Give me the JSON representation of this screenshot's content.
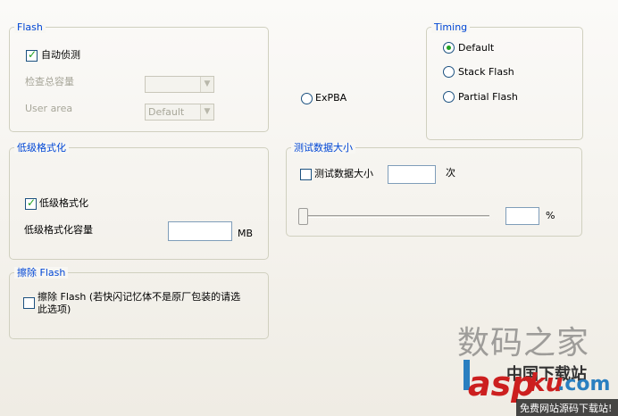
{
  "flash_group": {
    "title": "Flash",
    "auto_detect": {
      "label": "自动侦测",
      "checked": true
    },
    "total_capacity_label": "检查总容量",
    "total_capacity_value": "",
    "user_area_label": "User area",
    "user_area_value": "Default"
  },
  "timing_group": {
    "title": "Timing",
    "options": [
      {
        "label": "Default",
        "selected": true
      },
      {
        "label": "Stack Flash",
        "selected": false
      },
      {
        "label": "Partial Flash",
        "selected": false
      }
    ]
  },
  "expba": {
    "label": "ExPBA",
    "selected": false
  },
  "low_format_group": {
    "title": "低级格式化",
    "checkbox": {
      "label": "低级格式化",
      "checked": true
    },
    "capacity_label": "低级格式化容量",
    "capacity_value": "",
    "unit": "MB"
  },
  "test_group": {
    "title": "测试数据大小",
    "checkbox": {
      "label": "测试数据大小",
      "checked": false
    },
    "count_value": "",
    "count_unit": "次",
    "slider_value": 0,
    "percent_value": "",
    "percent_unit": "%"
  },
  "erase_group": {
    "title": "擦除 Flash",
    "checkbox": {
      "label_line1": "擦除 Flash (若快闪记忆体不是原厂包装的请选",
      "label_line2": "此选项)",
      "checked": false
    }
  },
  "watermark": {
    "line1": "数码之家",
    "line2": "asp",
    "line3": "ku",
    "line4": ".com",
    "cn": "中国下载站",
    "footer": "免费网站源码下载站!"
  },
  "colors": {
    "accent": "#0046d5",
    "check": "#21a121",
    "watermark_red": "#cc1f1f"
  }
}
